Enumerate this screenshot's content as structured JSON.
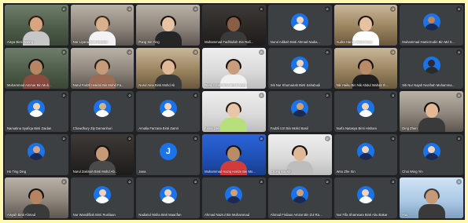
{
  "colors": {
    "page_background": "#fff9b0",
    "meeting_background": "#202124",
    "tile_background": "#3c4043",
    "active_speaker_border": "#8ab4f8"
  },
  "participants": [
    {
      "name": "Aisya Binti Awang",
      "view": "video",
      "scene": "plant",
      "skin": "#d7a57f",
      "hair": "#2b1d16",
      "clothing": "#c7c7c7"
    },
    {
      "name": "Nur Liyana Binti Mazlan",
      "view": "video",
      "scene": "room",
      "skin": "#d9b08c",
      "hair": "#3a2a22",
      "clothing": "#f3f3f3"
    },
    {
      "name": "Pang Sin Ying",
      "view": "video",
      "scene": "room",
      "skin": "#e8c3a3",
      "hair": "#1b1412",
      "clothing": "#252525"
    },
    {
      "name": "Muhammad Fadhlullah Bin Rafi...",
      "view": "video",
      "scene": "dark",
      "skin": "#8a5e43",
      "hair": "#161010",
      "clothing": "#3a3a3a"
    },
    {
      "name": "Nurul Adibah Binti Ahmad Nadia...",
      "view": "avatar",
      "avatar_color": "#1a73e8",
      "avatar_head": "#f2d3bd",
      "avatar_body": "#ffffff"
    },
    {
      "name": "Audra Hanan Binti Imran",
      "view": "video",
      "scene": "shelf",
      "skin": "#e6c2a2",
      "hair": "#1d1512",
      "clothing": "#ffffff"
    },
    {
      "name": "Muhammad Hamizzudin Bin Md Saf...",
      "view": "avatar",
      "avatar_color": "#1a73e8",
      "avatar_head": "#b8845e",
      "avatar_body": "#1b2a50"
    },
    {
      "name": "Muhammad Ammar Bin Muh...",
      "view": "video",
      "scene": "plant",
      "skin": "#b68563",
      "hair": "#161010",
      "clothing": "#8a4a3e"
    },
    {
      "name": "Nurul Fadzil Hakimi Bin Mohd Fa...",
      "view": "video",
      "scene": "room",
      "skin": "#c79a7a",
      "hair": "#2a1e18",
      "clothing": "#9a6c56"
    },
    {
      "name": "Nurul Aina Binti Mohd Ali",
      "view": "video",
      "scene": "shelf",
      "skin": "#e1b998",
      "hair": "#2a1e18",
      "clothing": "#3a3a3a"
    },
    {
      "name": "Nurul Izzah Binti Mohd Nazri",
      "view": "video",
      "scene": "light",
      "skin": "#c89d7b",
      "hair": "#161010",
      "clothing": "#f0f0f0"
    },
    {
      "name": "Siti Nur Khumairah Binti Sahabudi",
      "view": "avatar",
      "avatar_color": "#1a73e8",
      "avatar_head": "#f2d3bd",
      "avatar_body": "#ffffff"
    },
    {
      "name": "Nik Haiku Bin Nik Abdul Wahab Ihs...",
      "view": "video",
      "scene": "shelf",
      "skin": "#b98b66",
      "hair": "#161010",
      "clothing": "#202020"
    },
    {
      "name": "Siti Nur Najah Nazihah Muhammad...",
      "view": "avatar",
      "avatar_color": "#1a73e8",
      "avatar_head": "#2b2b2b",
      "avatar_body": "#2b2b2b"
    },
    {
      "name": "Namatina Syafiqa Binti Zaidan",
      "view": "avatar",
      "avatar_color": "#1a73e8",
      "avatar_head": "#f2d3bd",
      "avatar_body": "#ffffff"
    },
    {
      "name": "Chowdhury Zip Damanhuri",
      "view": "avatar",
      "avatar_color": "#1a73e8",
      "avatar_head": "#d7b08f",
      "avatar_body": "#ffffff"
    },
    {
      "name": "Amalia Farzana Binti Zamri",
      "view": "avatar",
      "avatar_color": "#1a73e8",
      "avatar_head": "#f2d3bd",
      "avatar_body": "#ffffff"
    },
    {
      "name": "Fiona Lee",
      "view": "video",
      "scene": "light",
      "skin": "#e9c5a8",
      "hair": "#2a1e18",
      "clothing": "#b7e07d"
    },
    {
      "name": "Fadzli Izzt Bin Mohd Basil",
      "view": "avatar",
      "avatar_color": "#1a73e8",
      "avatar_head": "#cf9f79",
      "avatar_body": "#1b2a50"
    },
    {
      "name": "Nurfa Natasya Binti Hisham",
      "view": "avatar",
      "avatar_color": "#1a73e8",
      "avatar_head": "#f2d3bd",
      "avatar_body": "#ffffff"
    },
    {
      "name": "Ding Zhen",
      "view": "video",
      "scene": "room",
      "skin": "#e4b894",
      "hair": "#161010",
      "clothing": "#3a3a3a"
    },
    {
      "name": "Ho Ting Ding",
      "view": "avatar",
      "avatar_color": "#1a73e8",
      "avatar_head": "#d7a57f",
      "avatar_body": "#1b2a50"
    },
    {
      "name": "Nurul Zakinah Binti Mohd Ab...",
      "view": "video",
      "scene": "dark",
      "skin": "#c69a76",
      "hair": "#161010",
      "clothing": "#4a4a4a"
    },
    {
      "name": "Jana",
      "view": "initial",
      "initial": "J",
      "avatar_color": "#1a73e8"
    },
    {
      "name": "Muhammad Haziq Hakim Bin Mo...",
      "view": "video",
      "scene": "blue",
      "skin": "#b98b66",
      "hair": "#161010",
      "clothing": "#d23b3b"
    },
    {
      "name": "Chong Kai Kit",
      "view": "video",
      "scene": "light",
      "skin": "#e0b896",
      "hair": "#161010",
      "clothing": "#bdbdbd"
    },
    {
      "name": "Woo Zhe Xin",
      "view": "avatar",
      "avatar_color": "#1a73e8",
      "avatar_head": "#f2d3bd",
      "avatar_body": "#1b2a50"
    },
    {
      "name": "Choi Wing Yin",
      "view": "avatar",
      "avatar_color": "#1a73e8",
      "avatar_head": "#f2d3bd",
      "avatar_body": "#1b2a50"
    },
    {
      "name": "Aisyah Binti Ahmad",
      "view": "video",
      "scene": "room",
      "skin": "#b58461",
      "hair": "#161010",
      "clothing": "#3a3a3a"
    },
    {
      "name": "Nur Wandifilah Binti Rusliaan",
      "view": "avatar",
      "avatar_color": "#1a73e8",
      "avatar_head": "#f2d3bd",
      "avatar_body": "#ffffff"
    },
    {
      "name": "Nadiatul Nisha Binti Maarifan",
      "view": "avatar",
      "avatar_color": "#1a73e8",
      "avatar_head": "#f2d3bd",
      "avatar_body": "#ffffff"
    },
    {
      "name": "Ahmad Nazrul Bin Muhammad",
      "view": "avatar",
      "avatar_color": "#1a73e8",
      "avatar_head": "#cf9f79",
      "avatar_body": "#1b2a50"
    },
    {
      "name": "Ahmad Firdaus Amzar Bin Zul Rash...",
      "view": "avatar",
      "avatar_color": "#1a73e8",
      "avatar_head": "#cf9f79",
      "avatar_body": "#1b2a50"
    },
    {
      "name": "Nur Fifa Shamsara Binti Abu Bakar",
      "view": "avatar",
      "avatar_color": "#1a73e8",
      "avatar_head": "#f2d3bd",
      "avatar_body": "#ffffff"
    },
    {
      "name": "You",
      "view": "video",
      "scene": "lightblue",
      "skin": "#c69a76",
      "hair": "#3a3a3a",
      "clothing": "#3a3a3a",
      "active": true
    }
  ]
}
